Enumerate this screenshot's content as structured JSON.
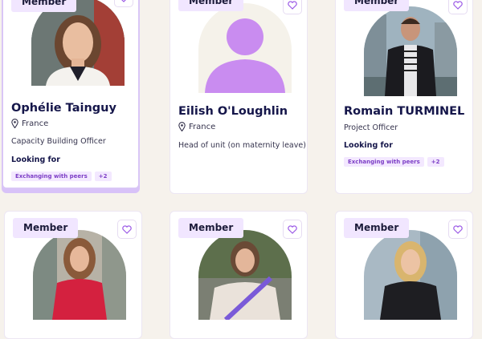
{
  "members": [
    {
      "badge": "Member",
      "name": "Ophélie Tainguy",
      "location": "France",
      "role": "Capacity Building Officer",
      "looking_for_label": "Looking for",
      "tags": [
        "Exchanging with peers",
        "+2"
      ]
    },
    {
      "badge": "Member",
      "name": "Eilish O'Loughlin",
      "location": "France",
      "role": "Head of unit (on maternity leave)"
    },
    {
      "badge": "Member",
      "name": "Romain TURMINEL",
      "role": "Project Officer",
      "looking_for_label": "Looking for",
      "tags": [
        "Exchanging with peers",
        "+2"
      ]
    },
    {
      "badge": "Member"
    },
    {
      "badge": "Member"
    },
    {
      "badge": "Member"
    }
  ],
  "icons": {
    "favorite": "heart-outline-icon",
    "location": "map-pin-icon",
    "placeholder_avatar": "person-silhouette-icon"
  },
  "colors": {
    "accent": "#9b59e6",
    "badge_bg": "#f1e6ff",
    "tag_text": "#7d3fc6",
    "placeholder": "#c98cf0",
    "page_bg": "#f6f2ec"
  }
}
